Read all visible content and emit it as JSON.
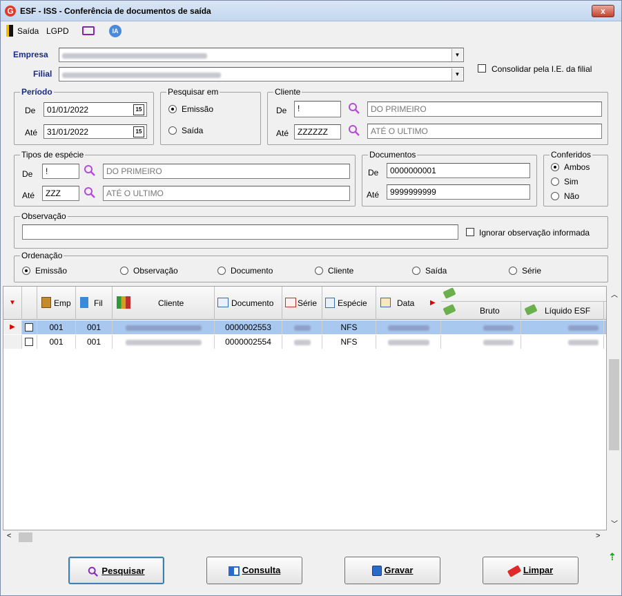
{
  "window": {
    "title": "ESF - ISS - Conferência de documentos de saída",
    "close": "x"
  },
  "menu": {
    "exit": "Saída",
    "lgpd": "LGPD",
    "ia": "IA"
  },
  "empresa": {
    "label": "Empresa"
  },
  "filial": {
    "label": "Filial"
  },
  "consolidar": {
    "label": "Consolidar pela I.E. da filial"
  },
  "periodo": {
    "title": "Período",
    "de_label": "De",
    "de_value": "01/01/2022",
    "ate_label": "Até",
    "ate_value": "31/01/2022"
  },
  "pesquisar_em": {
    "title": "Pesquisar em",
    "opt1": "Emissão",
    "opt2": "Saída"
  },
  "cliente": {
    "title": "Cliente",
    "de_label": "De",
    "de_value": "!",
    "de_desc": "DO PRIMEIRO",
    "ate_label": "Até",
    "ate_value": "ZZZZZZ",
    "ate_desc": "ATÉ O ULTIMO"
  },
  "tipos": {
    "title": "Tipos de espécie",
    "de_label": "De",
    "de_value": "!",
    "de_desc": "DO PRIMEIRO",
    "ate_label": "Até",
    "ate_value": "ZZZ",
    "ate_desc": "ATÉ O ULTIMO"
  },
  "documentos": {
    "title": "Documentos",
    "de_label": "De",
    "de_value": "0000000001",
    "ate_label": "Até",
    "ate_value": "9999999999"
  },
  "conferidos": {
    "title": "Conferidos",
    "opt1": "Ambos",
    "opt2": "Sim",
    "opt3": "Não"
  },
  "observacao": {
    "title": "Observação",
    "value": "",
    "ignore_label": "Ignorar observação informada"
  },
  "ordenacao": {
    "title": "Ordenação",
    "opts": [
      "Emissão",
      "Observação",
      "Documento",
      "Cliente",
      "Saída",
      "Série"
    ]
  },
  "grid": {
    "headers": {
      "emp": "Emp",
      "fil": "Fil",
      "cliente": "Cliente",
      "documento": "Documento",
      "serie": "Série",
      "especie": "Espécie",
      "data": "Data",
      "bruto": "Bruto",
      "liquido": "Líquido ESF"
    },
    "rows": [
      {
        "emp": "001",
        "fil": "001",
        "documento": "0000002553",
        "especie": "NFS"
      },
      {
        "emp": "001",
        "fil": "001",
        "documento": "0000002554",
        "especie": "NFS"
      }
    ]
  },
  "buttons": {
    "pesquisar": "Pesquisar",
    "consulta": "Consulta",
    "gravar": "Gravar",
    "limpar": "Limpar"
  },
  "colors": {
    "title_bar": "#c4d7ef",
    "selected_row": "#a9c8f0",
    "accent_red": "#e23a2a"
  }
}
